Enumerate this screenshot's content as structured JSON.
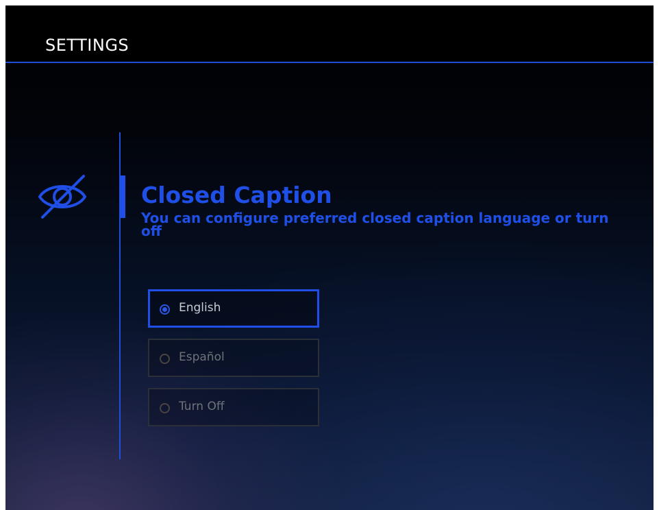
{
  "header": {
    "title": "SETTINGS"
  },
  "section": {
    "icon": "closed-caption-off-icon",
    "title": "Closed Caption",
    "description": "You can configure preferred closed caption language or turn off"
  },
  "options": [
    {
      "label": "English",
      "selected": true
    },
    {
      "label": "Español",
      "selected": false
    },
    {
      "label": "Turn Off",
      "selected": false
    }
  ],
  "colors": {
    "accent": "#1f4fe6",
    "header_background": "#000000",
    "text_primary": "#ffffff",
    "option_border": "#2b3038"
  }
}
